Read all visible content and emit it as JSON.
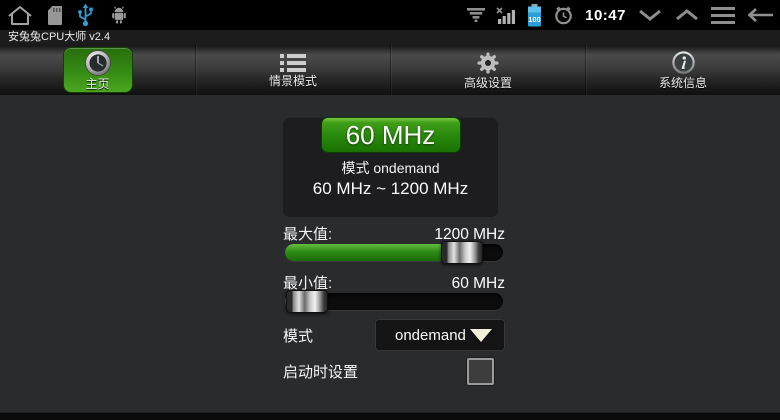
{
  "status_bar": {
    "left_icons": [
      "home-icon",
      "sdcard-icon",
      "usb-icon",
      "android-robot-icon"
    ],
    "tray_icons": [
      "data-funnel-icon",
      "signal-no-service-icon",
      "battery-icon",
      "alarm-clock-icon"
    ],
    "battery_level": "100",
    "time": "10:47",
    "nav_icons": [
      "chevron-down-icon",
      "chevron-up-icon",
      "menu-icon",
      "back-arrow-icon"
    ]
  },
  "title_bar": {
    "app_title": "安兔兔CPU大师 v2.4"
  },
  "tab_bar": {
    "tabs": [
      {
        "label": "主页",
        "icon": "gauge-icon",
        "active": true
      },
      {
        "label": "情景模式",
        "icon": "list-icon",
        "active": false
      },
      {
        "label": "高级设置",
        "icon": "gear-icon",
        "active": false
      },
      {
        "label": "系统信息",
        "icon": "info-icon",
        "active": false
      }
    ]
  },
  "cpu_panel": {
    "current_frequency": "60 MHz",
    "governor_line": "模式 ondemand",
    "frequency_range": "60 MHz ~ 1200 MHz"
  },
  "max_frequency": {
    "label": "最大值:",
    "value": "1200 MHz",
    "slider_percent": 81
  },
  "min_frequency": {
    "label": "最小值:",
    "value": "60 MHz",
    "slider_percent": 10
  },
  "governor": {
    "label": "模式",
    "selected": "ondemand"
  },
  "set_on_boot": {
    "label": "启动时设置",
    "checked": false
  },
  "colors": {
    "accent_green": "#2f8c17",
    "active_tab_green": "#3c9718",
    "battery_blue": "#2d9fd8",
    "usb_blue": "#2b9fd6"
  }
}
